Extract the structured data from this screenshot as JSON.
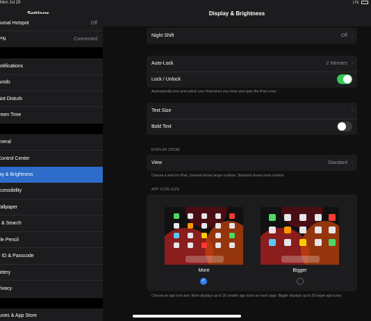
{
  "status": {
    "time": "Mon Jul 29",
    "signal": "LTE"
  },
  "sidebar": {
    "title": "Settings",
    "group1": [
      {
        "label": "Personal Hotspot",
        "value": "Off"
      },
      {
        "label": "VPN",
        "value": "Connected"
      }
    ],
    "group2": [
      {
        "label": "Notifications"
      },
      {
        "label": "Sounds"
      },
      {
        "label": "Do Not Disturb"
      },
      {
        "label": "Screen Time"
      }
    ],
    "group3": [
      {
        "label": "General"
      },
      {
        "label": "Control Center"
      },
      {
        "label": "Display & Brightness"
      },
      {
        "label": "Accessibility"
      },
      {
        "label": "Wallpaper"
      },
      {
        "label": "Siri & Search"
      },
      {
        "label": "Apple Pencil"
      },
      {
        "label": "Face ID & Passcode"
      },
      {
        "label": "Battery"
      },
      {
        "label": "Privacy"
      }
    ],
    "group4": [
      {
        "label": "iTunes & App Store"
      }
    ]
  },
  "main": {
    "title": "Display & Brightness",
    "night_shift": {
      "label": "Night Shift",
      "value": "Off"
    },
    "auto_lock": {
      "label": "Auto-Lock",
      "value": "2 Minutes"
    },
    "lock_unlock": {
      "label": "Lock / Unlock",
      "on": true
    },
    "lock_note": "Automatically lock and unlock your iPad when you close and open the iPad cover.",
    "text_size": {
      "label": "Text Size"
    },
    "bold_text": {
      "label": "Bold Text",
      "on": false
    },
    "display_zoom_header": "DISPLAY ZOOM",
    "view": {
      "label": "View",
      "value": "Standard"
    },
    "view_note": "Choose a view for iPad. Zoomed shows larger controls. Standard shows more content.",
    "app_icon_header": "APP ICON SIZE",
    "option_more": "More",
    "option_bigger": "Bigger",
    "selected_option": "More",
    "icon_note": "Choose an app icon size. More displays up to 30 smaller app icons on each page. Bigger displays up to 20 larger app icons."
  },
  "colors": {
    "accent": "#2f80ed",
    "toggle_on": "#34c759",
    "selected_row": "#2d6cc9"
  },
  "icons": {
    "chevron": "chevron-right-icon",
    "check": "checkmark-icon"
  }
}
